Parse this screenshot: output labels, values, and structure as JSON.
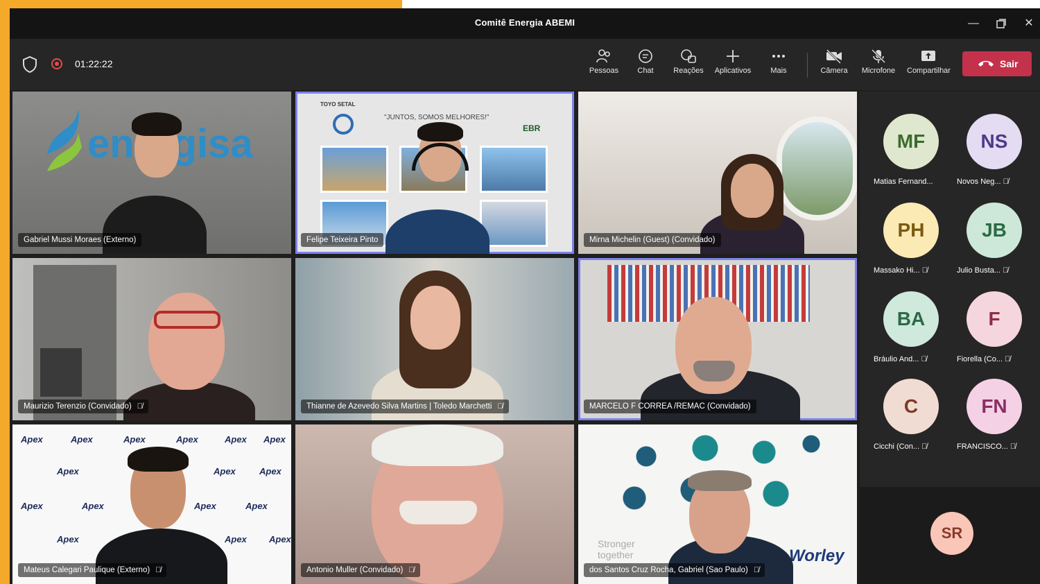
{
  "window": {
    "title": "Comitê Energia ABEMI"
  },
  "meeting": {
    "timer": "01:22:22"
  },
  "toolbar": {
    "people": "Pessoas",
    "chat": "Chat",
    "reactions": "Reações",
    "apps": "Aplicativos",
    "more": "Mais",
    "camera": "Câmera",
    "microphone": "Microfone",
    "share": "Compartilhar",
    "leave": "Sair"
  },
  "tiles": [
    {
      "name": "Gabriel Mussi Moraes (Externo)",
      "muted": false
    },
    {
      "name": "Felipe Teixeira Pinto",
      "muted": false
    },
    {
      "name": "Mirna Michelin (Guest) (Convidado)",
      "muted": false
    },
    {
      "name": "Maurizio Terenzio (Convidado)",
      "muted": true
    },
    {
      "name": "Thianne de Azevedo Silva Martins | Toledo Marchetti",
      "muted": true
    },
    {
      "name": "MARCELO F CORREA /REMAC (Convidado)",
      "muted": false
    },
    {
      "name": "Mateus Calegari Paulique (Externo)",
      "muted": true
    },
    {
      "name": "Antonio Muller (Convidado)",
      "muted": true
    },
    {
      "name": "dos Santos Cruz Rocha, Gabriel (Sao Paulo)",
      "muted": true
    }
  ],
  "backgrounds": {
    "energisa": "energisa",
    "toyo": "TOYO SETAL",
    "slogan": "\"JUNTOS, SOMOS MELHORES!\"",
    "ebr": "EBR",
    "apex": "Apex",
    "worley": "Worley",
    "stronger": "Stronger together"
  },
  "participants": [
    {
      "initials": "MF",
      "name": "Matias Fernand...",
      "muted": false,
      "bg": "#dfe8cf",
      "fg": "#3d6b2e"
    },
    {
      "initials": "NS",
      "name": "Novos Neg...",
      "muted": true,
      "bg": "#e4dcf2",
      "fg": "#4e3a8a"
    },
    {
      "initials": "PH",
      "name": "Massako Hi...",
      "muted": true,
      "bg": "#fbeab4",
      "fg": "#7a5a10"
    },
    {
      "initials": "JB",
      "name": "Julio Busta...",
      "muted": true,
      "bg": "#cde8d8",
      "fg": "#2b6a45"
    },
    {
      "initials": "BA",
      "name": "Bráulio And...",
      "muted": true,
      "bg": "#cfe9dc",
      "fg": "#2b6a45"
    },
    {
      "initials": "F",
      "name": "Fiorella (Co...",
      "muted": true,
      "bg": "#f6d6de",
      "fg": "#8a2f45"
    },
    {
      "initials": "C",
      "name": "Cicchi (Con...",
      "muted": true,
      "bg": "#f1dcd3",
      "fg": "#7a3b24"
    },
    {
      "initials": "FN",
      "name": "FRANCISCO...",
      "muted": true,
      "bg": "#f5d1e6",
      "fg": "#8a2f63"
    }
  ],
  "overflow_participant": {
    "initials": "SR"
  },
  "icons": {
    "mic_off": "mic-off-icon"
  }
}
